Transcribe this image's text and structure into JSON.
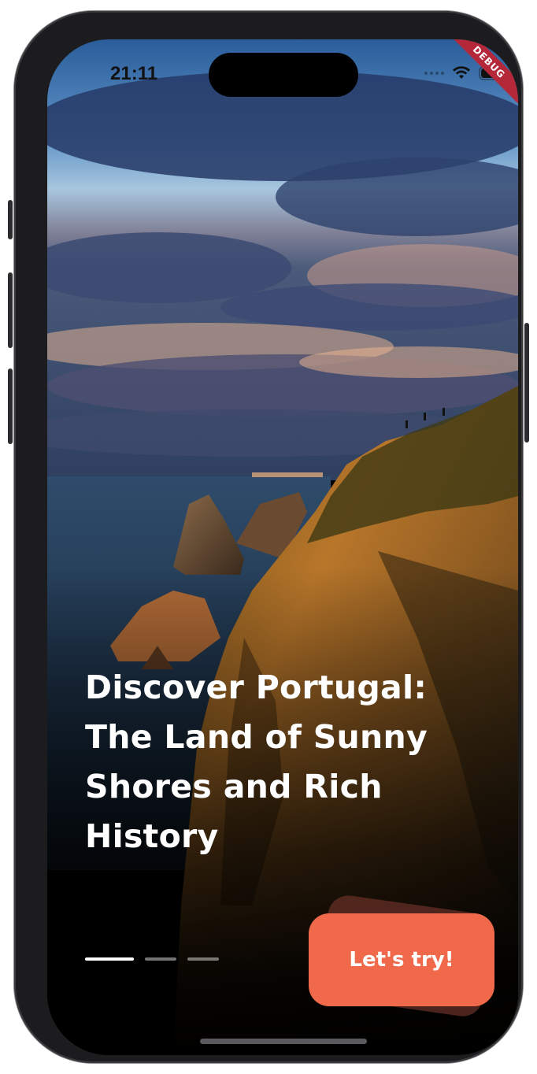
{
  "status_bar": {
    "time": "21:11",
    "debug_label": "DEBUG"
  },
  "onboarding": {
    "headline": "Discover Portugal: The Land of Sunny Shores and Rich History",
    "page_count": 3,
    "active_page": 1,
    "cta_label": "Let's try!"
  },
  "colors": {
    "accent": "#f0694a",
    "debug": "#b4283a"
  },
  "icons": [
    "wifi-icon",
    "battery-icon",
    "cellular-icon"
  ]
}
